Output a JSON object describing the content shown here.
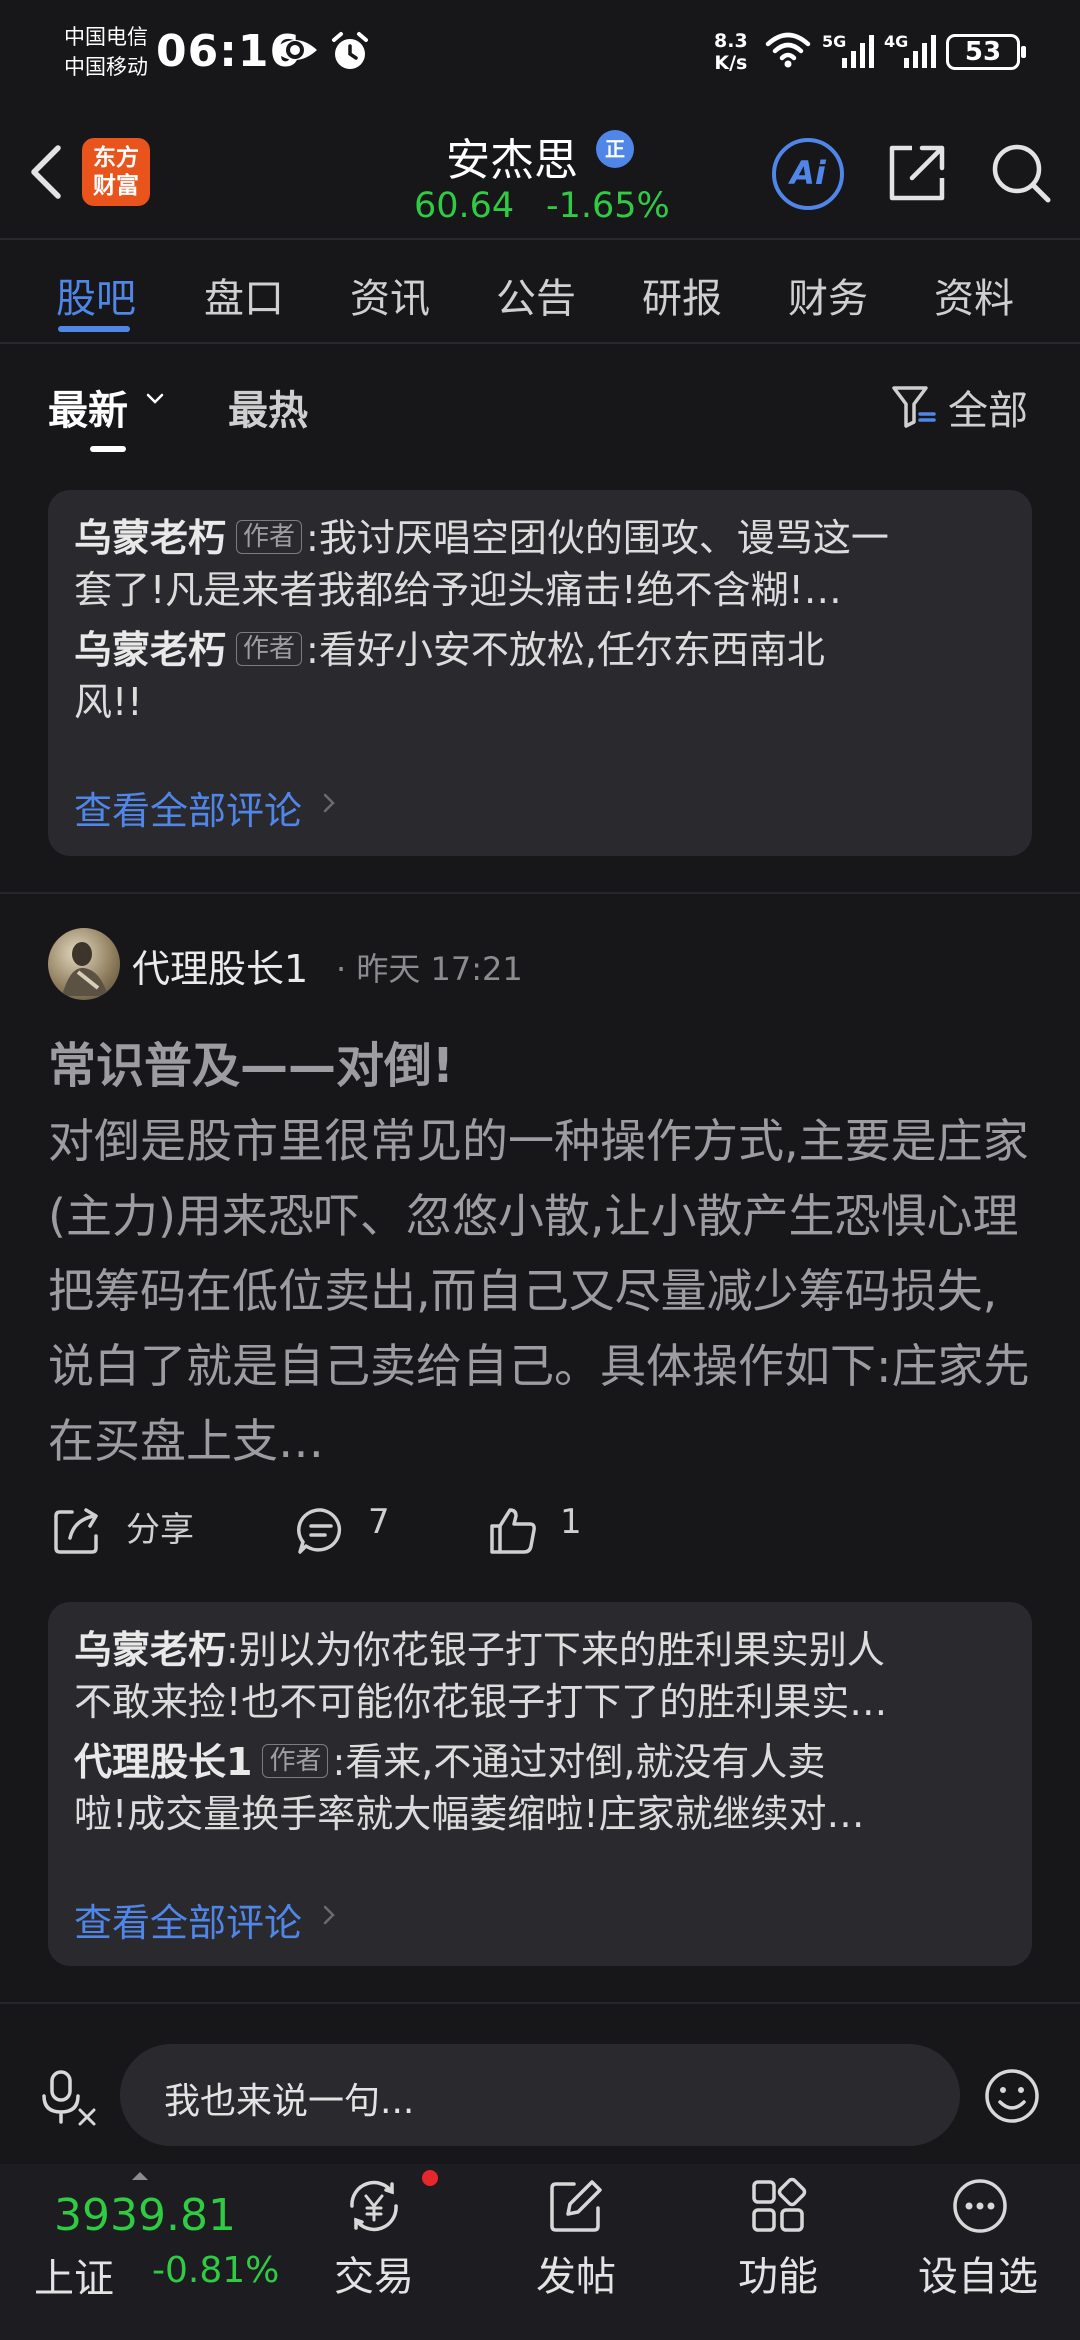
{
  "status_bar": {
    "carrier1": "中国电信",
    "carrier2": "中国移动",
    "time": "06:16",
    "net_speed_value": "8.3",
    "net_speed_unit": "K/s",
    "signal1": "5G",
    "signal2": "4G",
    "battery": "53"
  },
  "header": {
    "logo_line1": "东方",
    "logo_line2": "财富",
    "stock_name": "安杰思",
    "badge": "正",
    "price": "60.64",
    "change_pct": "-1.65%",
    "ai_label": "Ai"
  },
  "tabs": [
    "股吧",
    "盘口",
    "资讯",
    "公告",
    "研报",
    "财务",
    "资料"
  ],
  "sort": {
    "latest": "最新",
    "hot": "最热",
    "filter": "全部"
  },
  "first_comments": {
    "items": [
      {
        "author": "乌蒙老朽",
        "tag": "作者",
        "line1": ":我讨厌唱空团伙的围攻、谩骂这一",
        "line2": "套了!凡是来者我都给予迎头痛击!绝不含糊!…"
      },
      {
        "author": "乌蒙老朽",
        "tag": "作者",
        "line1": ":看好小安不放松,任尔东西南北",
        "line2": "风!!"
      }
    ],
    "view_all": "查看全部评论"
  },
  "post": {
    "author": "代理股长1",
    "time": "· 昨天 17:21",
    "title": "常识普及——对倒!",
    "body": "对倒是股市里很常见的一种操作方式,主要是庄家(主力)用来恐吓、忽悠小散,让小散产生恐惧心理把筹码在低位卖出,而自己又尽量减少筹码损失,说白了就是自己卖给自己。具体操作如下:庄家先在买盘上支…",
    "share_label": "分享",
    "comment_count": "7",
    "like_count": "1"
  },
  "second_comments": {
    "items": [
      {
        "author": "乌蒙老朽",
        "tag": "",
        "line1": ":别以为你花银子打下来的胜利果实别人",
        "line2": "不敢来捡!也不可能你花银子打下了的胜利果实…"
      },
      {
        "author": "代理股长1",
        "tag": "作者",
        "line1": ":看来,不通过对倒,就没有人卖",
        "line2": "啦!成交量换手率就大幅萎缩啦!庄家就继续对…"
      }
    ],
    "view_all": "查看全部评论"
  },
  "input": {
    "placeholder": "我也来说一句..."
  },
  "bottom_nav": {
    "index_value": "3939.81",
    "index_name": "上证",
    "index_change": "-0.81%",
    "items": [
      "交易",
      "发帖",
      "功能",
      "设自选"
    ]
  },
  "colors": {
    "accent": "#4f86e8",
    "down_green": "#2fcb43",
    "brand_orange": "#e9541c",
    "background": "#17171a"
  }
}
